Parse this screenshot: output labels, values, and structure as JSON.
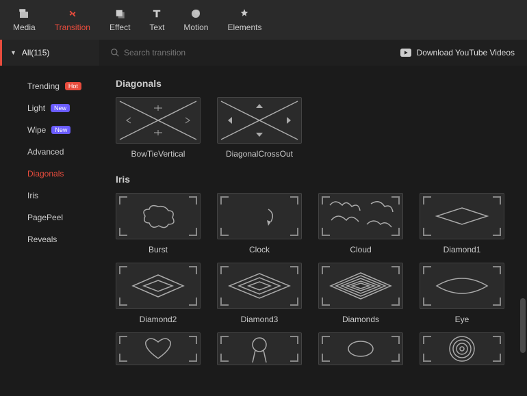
{
  "topTabs": [
    {
      "id": "media",
      "label": "Media"
    },
    {
      "id": "transition",
      "label": "Transition"
    },
    {
      "id": "effect",
      "label": "Effect"
    },
    {
      "id": "text",
      "label": "Text"
    },
    {
      "id": "motion",
      "label": "Motion"
    },
    {
      "id": "elements",
      "label": "Elements"
    }
  ],
  "activeTopTab": "transition",
  "categoryDropdown": "All(115)",
  "search": {
    "placeholder": "Search transition"
  },
  "downloadLink": "Download YouTube Videos",
  "sidebar": {
    "items": [
      {
        "label": "Trending",
        "badge": "Hot",
        "badgeClass": "hot"
      },
      {
        "label": "Light",
        "badge": "New",
        "badgeClass": "new"
      },
      {
        "label": "Wipe",
        "badge": "New",
        "badgeClass": "new"
      },
      {
        "label": "Advanced"
      },
      {
        "label": "Diagonals",
        "active": true
      },
      {
        "label": "Iris"
      },
      {
        "label": "PagePeel"
      },
      {
        "label": "Reveals"
      }
    ]
  },
  "sections": [
    {
      "title": "Diagonals",
      "items": [
        {
          "label": "BowTieVertical",
          "shape": "bowtie"
        },
        {
          "label": "DiagonalCrossOut",
          "shape": "crossout"
        }
      ]
    },
    {
      "title": "Iris",
      "items": [
        {
          "label": "Burst",
          "shape": "burst"
        },
        {
          "label": "Clock",
          "shape": "clock"
        },
        {
          "label": "Cloud",
          "shape": "cloud"
        },
        {
          "label": "Diamond1",
          "shape": "diamond1"
        },
        {
          "label": "Diamond2",
          "shape": "diamond2"
        },
        {
          "label": "Diamond3",
          "shape": "diamond3"
        },
        {
          "label": "Diamonds",
          "shape": "diamonds"
        },
        {
          "label": "Eye",
          "shape": "eye"
        },
        {
          "label": "Heart",
          "shape": "heart",
          "truncated": true
        },
        {
          "label": "Keyhole",
          "shape": "keyhole",
          "truncated": true
        },
        {
          "label": "Oval",
          "shape": "oval",
          "truncated": true
        },
        {
          "label": "Rings",
          "shape": "rings",
          "truncated": true
        }
      ]
    }
  ]
}
